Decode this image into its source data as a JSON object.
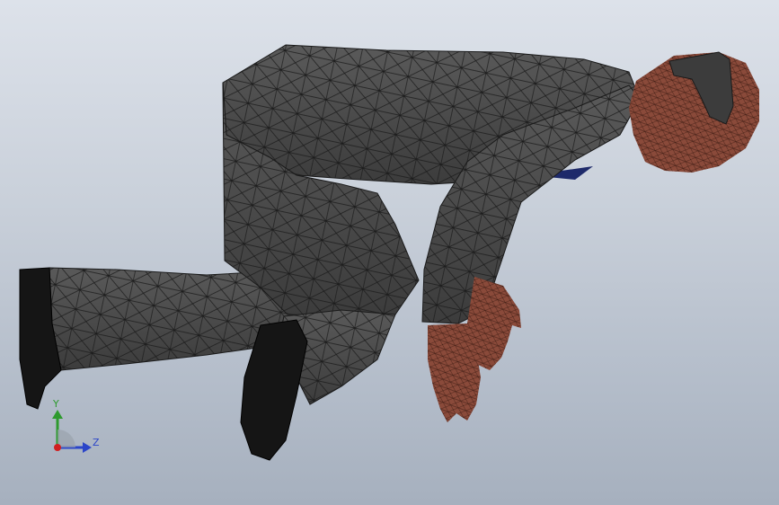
{
  "viewport": {
    "background_top": "#dde2ea",
    "background_bottom": "#a6b0be"
  },
  "model": {
    "icon": "crawling-human-mesh",
    "suit_color": "#4a4a4a",
    "skin_color": "#8a4a3a",
    "hair_color": "#3c3c3c",
    "mesh_edge_color": "#1a1a1a"
  },
  "triad": {
    "y_label": "Y",
    "z_label": "Z",
    "y_color": "#2e9a2e",
    "z_color": "#2b45c8",
    "origin_color": "#d02020"
  }
}
